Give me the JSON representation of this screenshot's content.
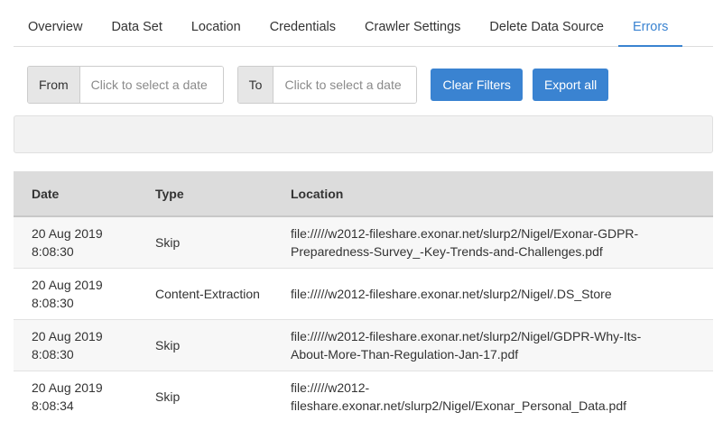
{
  "tabs": [
    {
      "label": "Overview",
      "active": false
    },
    {
      "label": "Data Set",
      "active": false
    },
    {
      "label": "Location",
      "active": false
    },
    {
      "label": "Credentials",
      "active": false
    },
    {
      "label": "Crawler Settings",
      "active": false
    },
    {
      "label": "Delete Data Source",
      "active": false
    },
    {
      "label": "Errors",
      "active": true
    }
  ],
  "filters": {
    "from_label": "From",
    "from_placeholder": "Click to select a date",
    "to_label": "To",
    "to_placeholder": "Click to select a date",
    "clear_label": "Clear Filters",
    "export_label": "Export all"
  },
  "colors": {
    "accent": "#3a83d1"
  },
  "table": {
    "headers": {
      "date": "Date",
      "type": "Type",
      "location": "Location"
    },
    "rows": [
      {
        "date": "20 Aug 2019",
        "time": "8:08:30",
        "type": "Skip",
        "location_1": "file://///w2012-fileshare.exonar.net/slurp2/Nigel/Exonar-GDPR-",
        "location_2": "Preparedness-Survey_-Key-Trends-and-Challenges.pdf"
      },
      {
        "date": "20 Aug 2019",
        "time": "8:08:30",
        "type": "Content-Extraction",
        "location_1": "file://///w2012-fileshare.exonar.net/slurp2/Nigel/.DS_Store",
        "location_2": ""
      },
      {
        "date": "20 Aug 2019",
        "time": "8:08:30",
        "type": "Skip",
        "location_1": "file://///w2012-fileshare.exonar.net/slurp2/Nigel/GDPR-Why-Its-",
        "location_2": "About-More-Than-Regulation-Jan-17.pdf"
      },
      {
        "date": "20 Aug 2019",
        "time": "8:08:34",
        "type": "Skip",
        "location_1": "file://///w2012-",
        "location_2": "fileshare.exonar.net/slurp2/Nigel/Exonar_Personal_Data.pdf"
      }
    ]
  }
}
